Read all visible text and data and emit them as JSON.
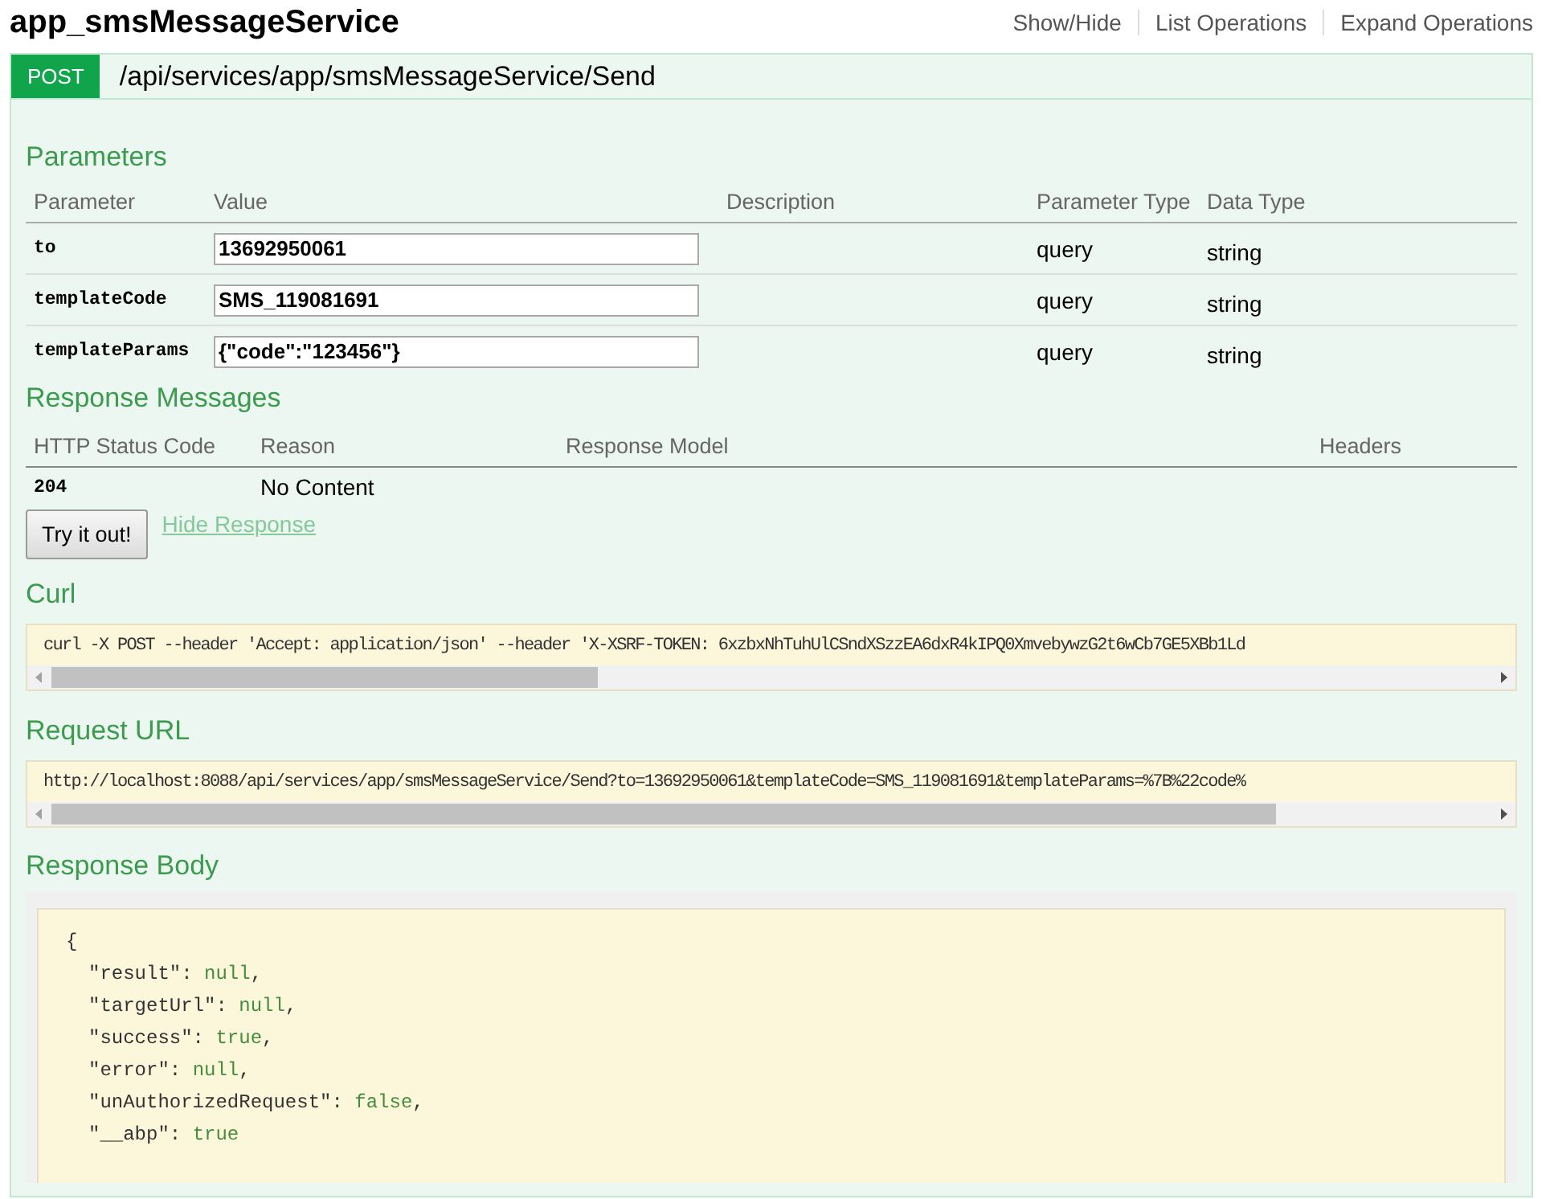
{
  "resource": {
    "title": "app_smsMessageService",
    "links": [
      "Show/Hide",
      "List Operations",
      "Expand Operations"
    ]
  },
  "operation": {
    "method": "POST",
    "path": "/api/services/app/smsMessageService/Send"
  },
  "parameters": {
    "title": "Parameters",
    "columns": [
      "Parameter",
      "Value",
      "Description",
      "Parameter Type",
      "Data Type"
    ],
    "rows": [
      {
        "name": "to",
        "value": "13692950061",
        "param_type": "query",
        "data_type": "string"
      },
      {
        "name": "templateCode",
        "value": "SMS_119081691",
        "param_type": "query",
        "data_type": "string"
      },
      {
        "name": "templateParams",
        "value": "{\"code\":\"123456\"}",
        "param_type": "query",
        "data_type": "string"
      }
    ]
  },
  "response_messages": {
    "title": "Response Messages",
    "columns": [
      "HTTP Status Code",
      "Reason",
      "Response Model",
      "Headers"
    ],
    "rows": [
      {
        "code": "204",
        "reason": "No Content"
      }
    ]
  },
  "try_button": "Try it out!",
  "hide_response_link": "Hide Response",
  "curl": {
    "title": "Curl",
    "text": "curl -X POST --header 'Accept: application/json' --header 'X-XSRF-TOKEN: 6xzbxNhTuhUlCSndXSzzEA6dxR4kIPQ0XmvebywzG2t6wCb7GE5XBb1Ld"
  },
  "request_url": {
    "title": "Request URL",
    "text": "http://localhost:8088/api/services/app/smsMessageService/Send?to=13692950061&templateCode=SMS_119081691&templateParams=%7B%22code%"
  },
  "response_body": {
    "title": "Response Body",
    "open": "{",
    "lines": [
      {
        "key": "\"result\":",
        "value": "null",
        "tail": ","
      },
      {
        "key": "\"targetUrl\":",
        "value": "null",
        "tail": ","
      },
      {
        "key": "\"success\":",
        "value": "true",
        "tail": ","
      },
      {
        "key": "\"error\":",
        "value": "null",
        "tail": ","
      },
      {
        "key": "\"unAuthorizedRequest\":",
        "value": "false",
        "tail": ","
      },
      {
        "key": "\"__abp\":",
        "value": "true"
      }
    ]
  }
}
